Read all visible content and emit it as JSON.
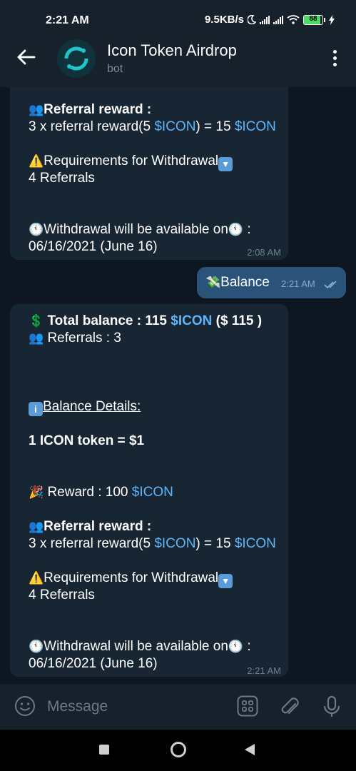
{
  "status": {
    "time": "2:21 AM",
    "speed": "9.5KB/s",
    "battery": "88"
  },
  "header": {
    "title": "Icon Token Airdrop",
    "subtitle": "bot"
  },
  "prev_message": {
    "referral_title": "Referral reward :",
    "referral_line_a": "3 x referral reward(5 ",
    "token": "$ICON",
    "referral_line_b": ") = 15 ",
    "req_title": "Requirements for Withdrawal",
    "req_value": "4 Referrals",
    "withdraw_text": "Withdrawal will be available on",
    "withdraw_suffix": " :",
    "withdraw_date": "06/16/2021 (June 16)",
    "time": "2:08 AM"
  },
  "out_message": {
    "text": "Balance",
    "time": "2:21 AM"
  },
  "balance_message": {
    "total_label": "Total balance : 115 ",
    "total_token": "$ICON",
    "total_usd": " ($ 115 )",
    "referrals": "Referrals : 3",
    "details": "Balance Details:",
    "rate": "1 ICON token = $1",
    "reward_label": "Reward : 100 ",
    "reward_token": "$ICON",
    "referral_title": "Referral reward :",
    "referral_line_a": "3 x referral reward(5 ",
    "token": "$ICON",
    "referral_line_b": ") = 15 ",
    "req_title": "Requirements for Withdrawal",
    "req_value": "4 Referrals",
    "withdraw_text": "Withdrawal will be available on",
    "withdraw_suffix": " :",
    "withdraw_date": "06/16/2021 (June 16)",
    "time": "2:21 AM"
  },
  "input": {
    "placeholder": "Message"
  },
  "colors": {
    "bg": "#0e1621",
    "bar": "#17212b",
    "bubble_in": "#182533",
    "bubble_out": "#2b5278",
    "link": "#5eb5f7"
  }
}
